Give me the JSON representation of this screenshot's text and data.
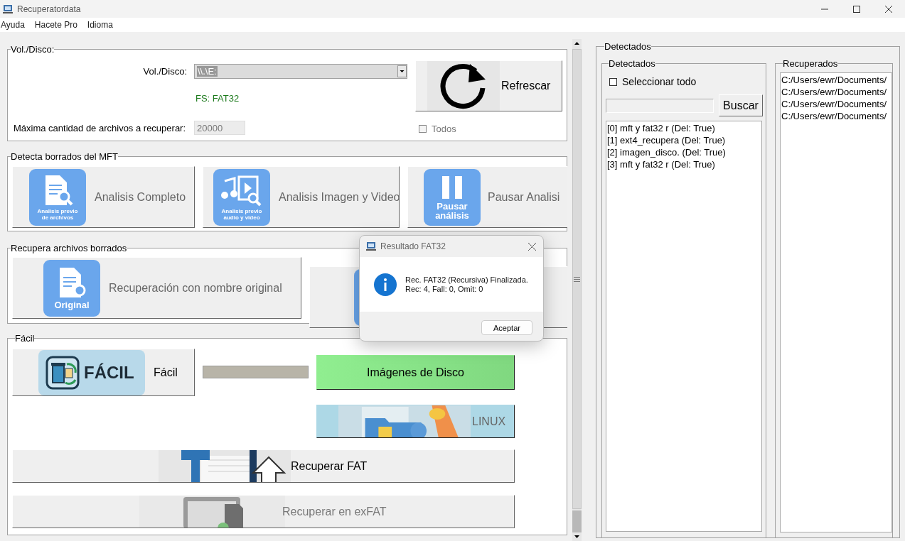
{
  "window": {
    "title": "Recuperatordata"
  },
  "menu": [
    {
      "label": "Ayuda"
    },
    {
      "label": "Hacete Pro"
    },
    {
      "label": "Idioma"
    }
  ],
  "volume": {
    "title": "Vol./Disco:",
    "drive_label": "Vol./Disco:",
    "drive_value": "\\\\.\\E:",
    "drive_value_highlighted": true,
    "filesystem": "FS: FAT32",
    "max_label": "Máxima cantidad de archivos a recuperar:",
    "max_value": "20000",
    "refresh": "Refrescar",
    "all": {
      "label": "Todos",
      "checked": false,
      "disabled": true
    }
  },
  "mft": {
    "title": "Detecta borrados del MFT",
    "buttons": [
      {
        "label": "Analisis Completo",
        "kind": "document-search",
        "caption": "Analisis previo de archivos"
      },
      {
        "label": "Analisis Imagen y Video",
        "kind": "media-search",
        "caption": "Analisis previo audio y video"
      },
      {
        "label": "Pausar Analisi",
        "kind": "pause",
        "caption": "Pausar análisis"
      }
    ]
  },
  "recover": {
    "title": "Recupera archivos borrados",
    "buttons": [
      {
        "label": "Recuperación con nombre original",
        "kind": "document-restore",
        "caption": "Original"
      },
      {
        "kind": "document-restore"
      }
    ]
  },
  "easy": {
    "title": "Fácil",
    "easy_button": {
      "label": "Fácil",
      "badge": "FÁCIL"
    },
    "disk_images": "Imágenes de Disco",
    "linux": {
      "label": "LINUX",
      "disabled": true
    },
    "buttons": [
      {
        "label": "Recuperar FAT",
        "kind": "fat",
        "disabled": false
      },
      {
        "label": "Recuperar en exFAT",
        "kind": "exfat",
        "disabled": true
      }
    ]
  },
  "detected": {
    "title": "Detectados",
    "list_title": "Detectados",
    "select_all": {
      "label": "Seleccionar todo",
      "checked": false
    },
    "search_button": "Buscar",
    "items": [
      "[0] mft y fat32 r (Del: True)",
      "[1] ext4_recupera (Del: True)",
      "[2] imagen_disco. (Del: True)",
      "[3] mft y fat32 r (Del: True)"
    ]
  },
  "recovered": {
    "title": "Recuperados",
    "items": [
      "C:/Users/ewr/Documents/",
      "C:/Users/ewr/Documents/",
      "C:/Users/ewr/Documents/",
      "C:/Users/ewr/Documents/"
    ]
  },
  "dialog": {
    "title": "Resultado FAT32",
    "message": "Rec. FAT32 (Recursiva) Finalizada.\nRec: 4, Fall: 0, Omit: 0",
    "button": "Aceptar"
  }
}
